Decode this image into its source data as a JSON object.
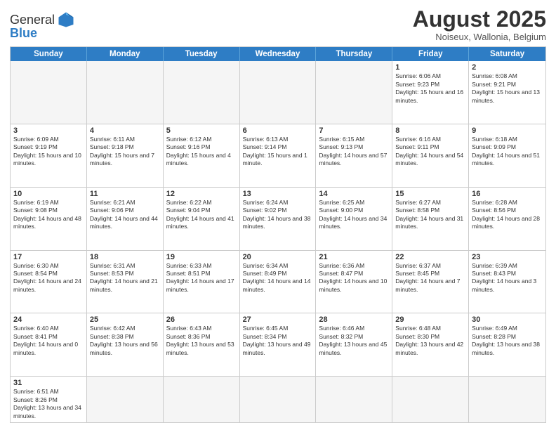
{
  "logo": {
    "text_general": "General",
    "text_blue": "Blue"
  },
  "header": {
    "title": "August 2025",
    "subtitle": "Noiseux, Wallonia, Belgium"
  },
  "weekdays": [
    "Sunday",
    "Monday",
    "Tuesday",
    "Wednesday",
    "Thursday",
    "Friday",
    "Saturday"
  ],
  "weeks": [
    [
      {
        "day": "",
        "info": "",
        "empty": true
      },
      {
        "day": "",
        "info": "",
        "empty": true
      },
      {
        "day": "",
        "info": "",
        "empty": true
      },
      {
        "day": "",
        "info": "",
        "empty": true
      },
      {
        "day": "",
        "info": "",
        "empty": true
      },
      {
        "day": "1",
        "info": "Sunrise: 6:06 AM\nSunset: 9:23 PM\nDaylight: 15 hours and 16 minutes."
      },
      {
        "day": "2",
        "info": "Sunrise: 6:08 AM\nSunset: 9:21 PM\nDaylight: 15 hours and 13 minutes."
      }
    ],
    [
      {
        "day": "3",
        "info": "Sunrise: 6:09 AM\nSunset: 9:19 PM\nDaylight: 15 hours and 10 minutes."
      },
      {
        "day": "4",
        "info": "Sunrise: 6:11 AM\nSunset: 9:18 PM\nDaylight: 15 hours and 7 minutes."
      },
      {
        "day": "5",
        "info": "Sunrise: 6:12 AM\nSunset: 9:16 PM\nDaylight: 15 hours and 4 minutes."
      },
      {
        "day": "6",
        "info": "Sunrise: 6:13 AM\nSunset: 9:14 PM\nDaylight: 15 hours and 1 minute."
      },
      {
        "day": "7",
        "info": "Sunrise: 6:15 AM\nSunset: 9:13 PM\nDaylight: 14 hours and 57 minutes."
      },
      {
        "day": "8",
        "info": "Sunrise: 6:16 AM\nSunset: 9:11 PM\nDaylight: 14 hours and 54 minutes."
      },
      {
        "day": "9",
        "info": "Sunrise: 6:18 AM\nSunset: 9:09 PM\nDaylight: 14 hours and 51 minutes."
      }
    ],
    [
      {
        "day": "10",
        "info": "Sunrise: 6:19 AM\nSunset: 9:08 PM\nDaylight: 14 hours and 48 minutes."
      },
      {
        "day": "11",
        "info": "Sunrise: 6:21 AM\nSunset: 9:06 PM\nDaylight: 14 hours and 44 minutes."
      },
      {
        "day": "12",
        "info": "Sunrise: 6:22 AM\nSunset: 9:04 PM\nDaylight: 14 hours and 41 minutes."
      },
      {
        "day": "13",
        "info": "Sunrise: 6:24 AM\nSunset: 9:02 PM\nDaylight: 14 hours and 38 minutes."
      },
      {
        "day": "14",
        "info": "Sunrise: 6:25 AM\nSunset: 9:00 PM\nDaylight: 14 hours and 34 minutes."
      },
      {
        "day": "15",
        "info": "Sunrise: 6:27 AM\nSunset: 8:58 PM\nDaylight: 14 hours and 31 minutes."
      },
      {
        "day": "16",
        "info": "Sunrise: 6:28 AM\nSunset: 8:56 PM\nDaylight: 14 hours and 28 minutes."
      }
    ],
    [
      {
        "day": "17",
        "info": "Sunrise: 6:30 AM\nSunset: 8:54 PM\nDaylight: 14 hours and 24 minutes."
      },
      {
        "day": "18",
        "info": "Sunrise: 6:31 AM\nSunset: 8:53 PM\nDaylight: 14 hours and 21 minutes."
      },
      {
        "day": "19",
        "info": "Sunrise: 6:33 AM\nSunset: 8:51 PM\nDaylight: 14 hours and 17 minutes."
      },
      {
        "day": "20",
        "info": "Sunrise: 6:34 AM\nSunset: 8:49 PM\nDaylight: 14 hours and 14 minutes."
      },
      {
        "day": "21",
        "info": "Sunrise: 6:36 AM\nSunset: 8:47 PM\nDaylight: 14 hours and 10 minutes."
      },
      {
        "day": "22",
        "info": "Sunrise: 6:37 AM\nSunset: 8:45 PM\nDaylight: 14 hours and 7 minutes."
      },
      {
        "day": "23",
        "info": "Sunrise: 6:39 AM\nSunset: 8:43 PM\nDaylight: 14 hours and 3 minutes."
      }
    ],
    [
      {
        "day": "24",
        "info": "Sunrise: 6:40 AM\nSunset: 8:41 PM\nDaylight: 14 hours and 0 minutes."
      },
      {
        "day": "25",
        "info": "Sunrise: 6:42 AM\nSunset: 8:38 PM\nDaylight: 13 hours and 56 minutes."
      },
      {
        "day": "26",
        "info": "Sunrise: 6:43 AM\nSunset: 8:36 PM\nDaylight: 13 hours and 53 minutes."
      },
      {
        "day": "27",
        "info": "Sunrise: 6:45 AM\nSunset: 8:34 PM\nDaylight: 13 hours and 49 minutes."
      },
      {
        "day": "28",
        "info": "Sunrise: 6:46 AM\nSunset: 8:32 PM\nDaylight: 13 hours and 45 minutes."
      },
      {
        "day": "29",
        "info": "Sunrise: 6:48 AM\nSunset: 8:30 PM\nDaylight: 13 hours and 42 minutes."
      },
      {
        "day": "30",
        "info": "Sunrise: 6:49 AM\nSunset: 8:28 PM\nDaylight: 13 hours and 38 minutes."
      }
    ],
    [
      {
        "day": "31",
        "info": "Sunrise: 6:51 AM\nSunset: 8:26 PM\nDaylight: 13 hours and 34 minutes."
      },
      {
        "day": "",
        "info": "",
        "empty": true
      },
      {
        "day": "",
        "info": "",
        "empty": true
      },
      {
        "day": "",
        "info": "",
        "empty": true
      },
      {
        "day": "",
        "info": "",
        "empty": true
      },
      {
        "day": "",
        "info": "",
        "empty": true
      },
      {
        "day": "",
        "info": "",
        "empty": true
      }
    ]
  ]
}
